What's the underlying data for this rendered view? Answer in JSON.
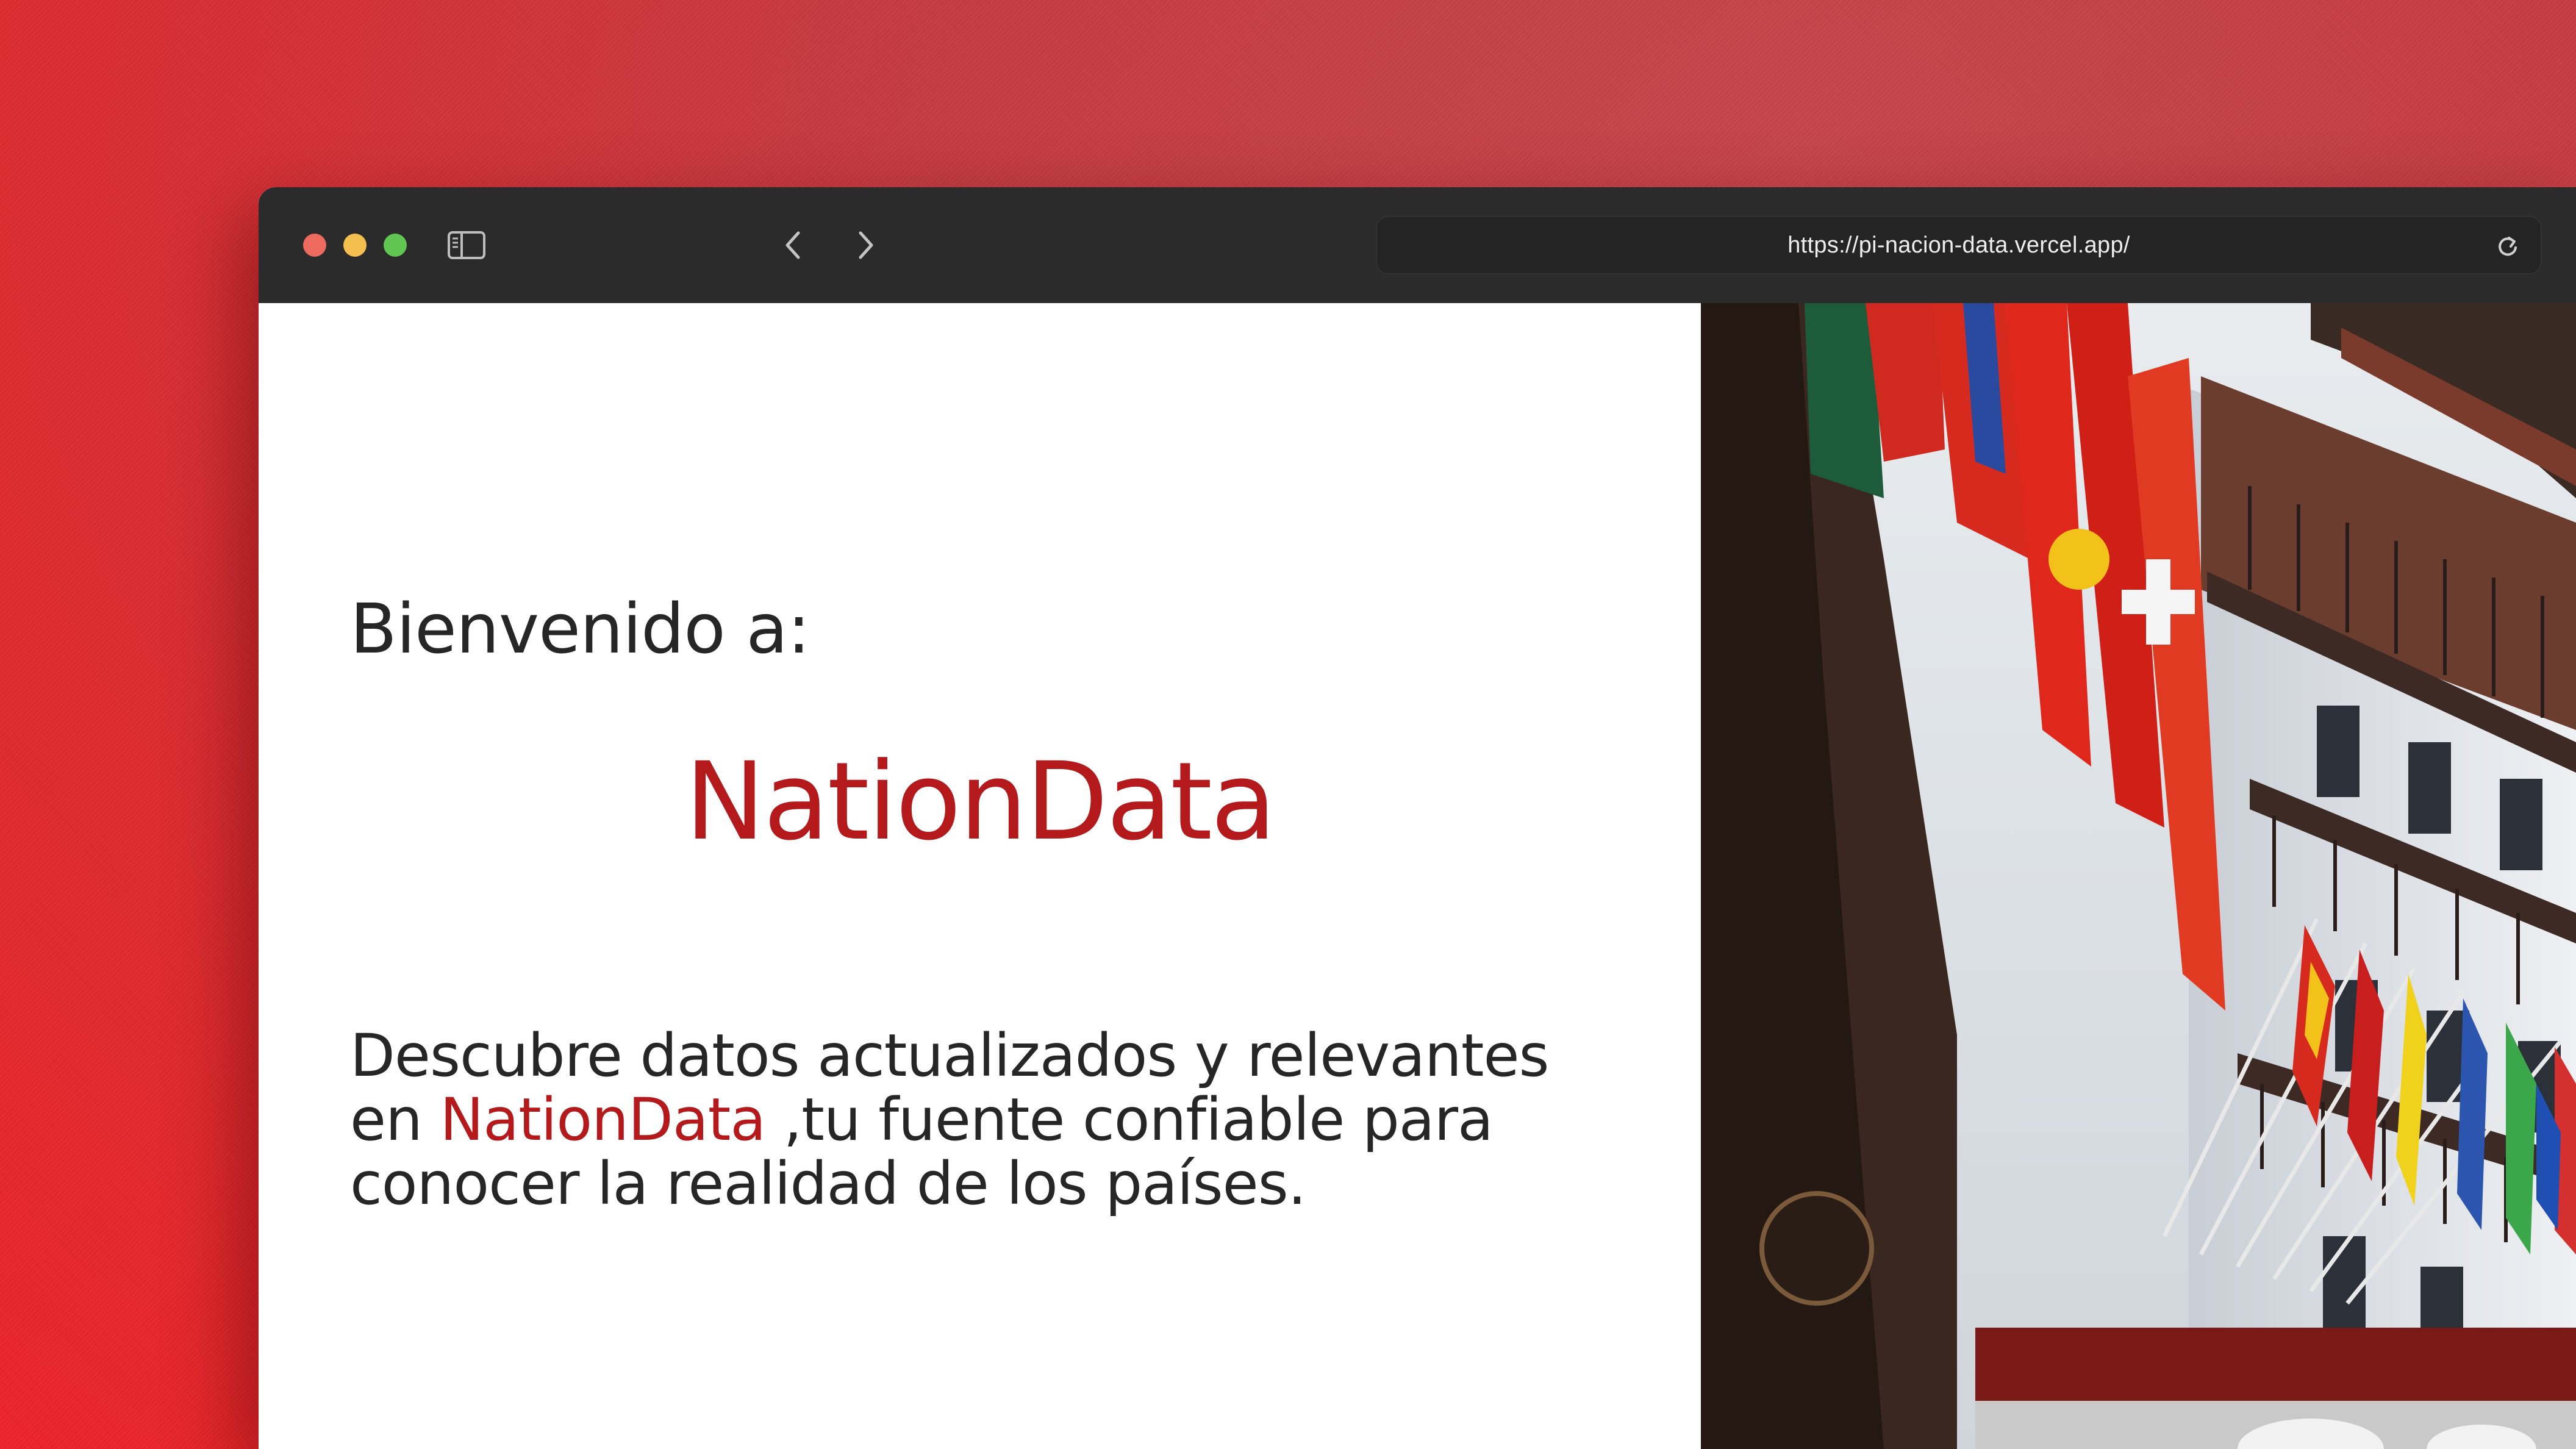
{
  "browser": {
    "url": "https://pi-nacion-data.vercel.app/",
    "icons": {
      "close": "close-dot",
      "minimize": "minimize-dot",
      "maximize": "maximize-dot",
      "sidebar": "sidebar-icon",
      "back": "chevron-left-icon",
      "forward": "chevron-right-icon",
      "reload": "reload-icon"
    }
  },
  "page": {
    "welcome": "Bienvenido a:",
    "brand": "NationData",
    "description": {
      "line1": "Descubre datos actualizados y relevantes",
      "prefix2": "en ",
      "brand_inline": "NationData",
      "suffix2": " ,tu fuente confiable para",
      "line3": "conocer la realidad de los países."
    },
    "accent_color": "#b41a1c",
    "hero_image": "building-with-international-flags"
  },
  "colors": {
    "background": "#e02a30",
    "toolbar": "#2b2b2b",
    "text": "#262626"
  }
}
